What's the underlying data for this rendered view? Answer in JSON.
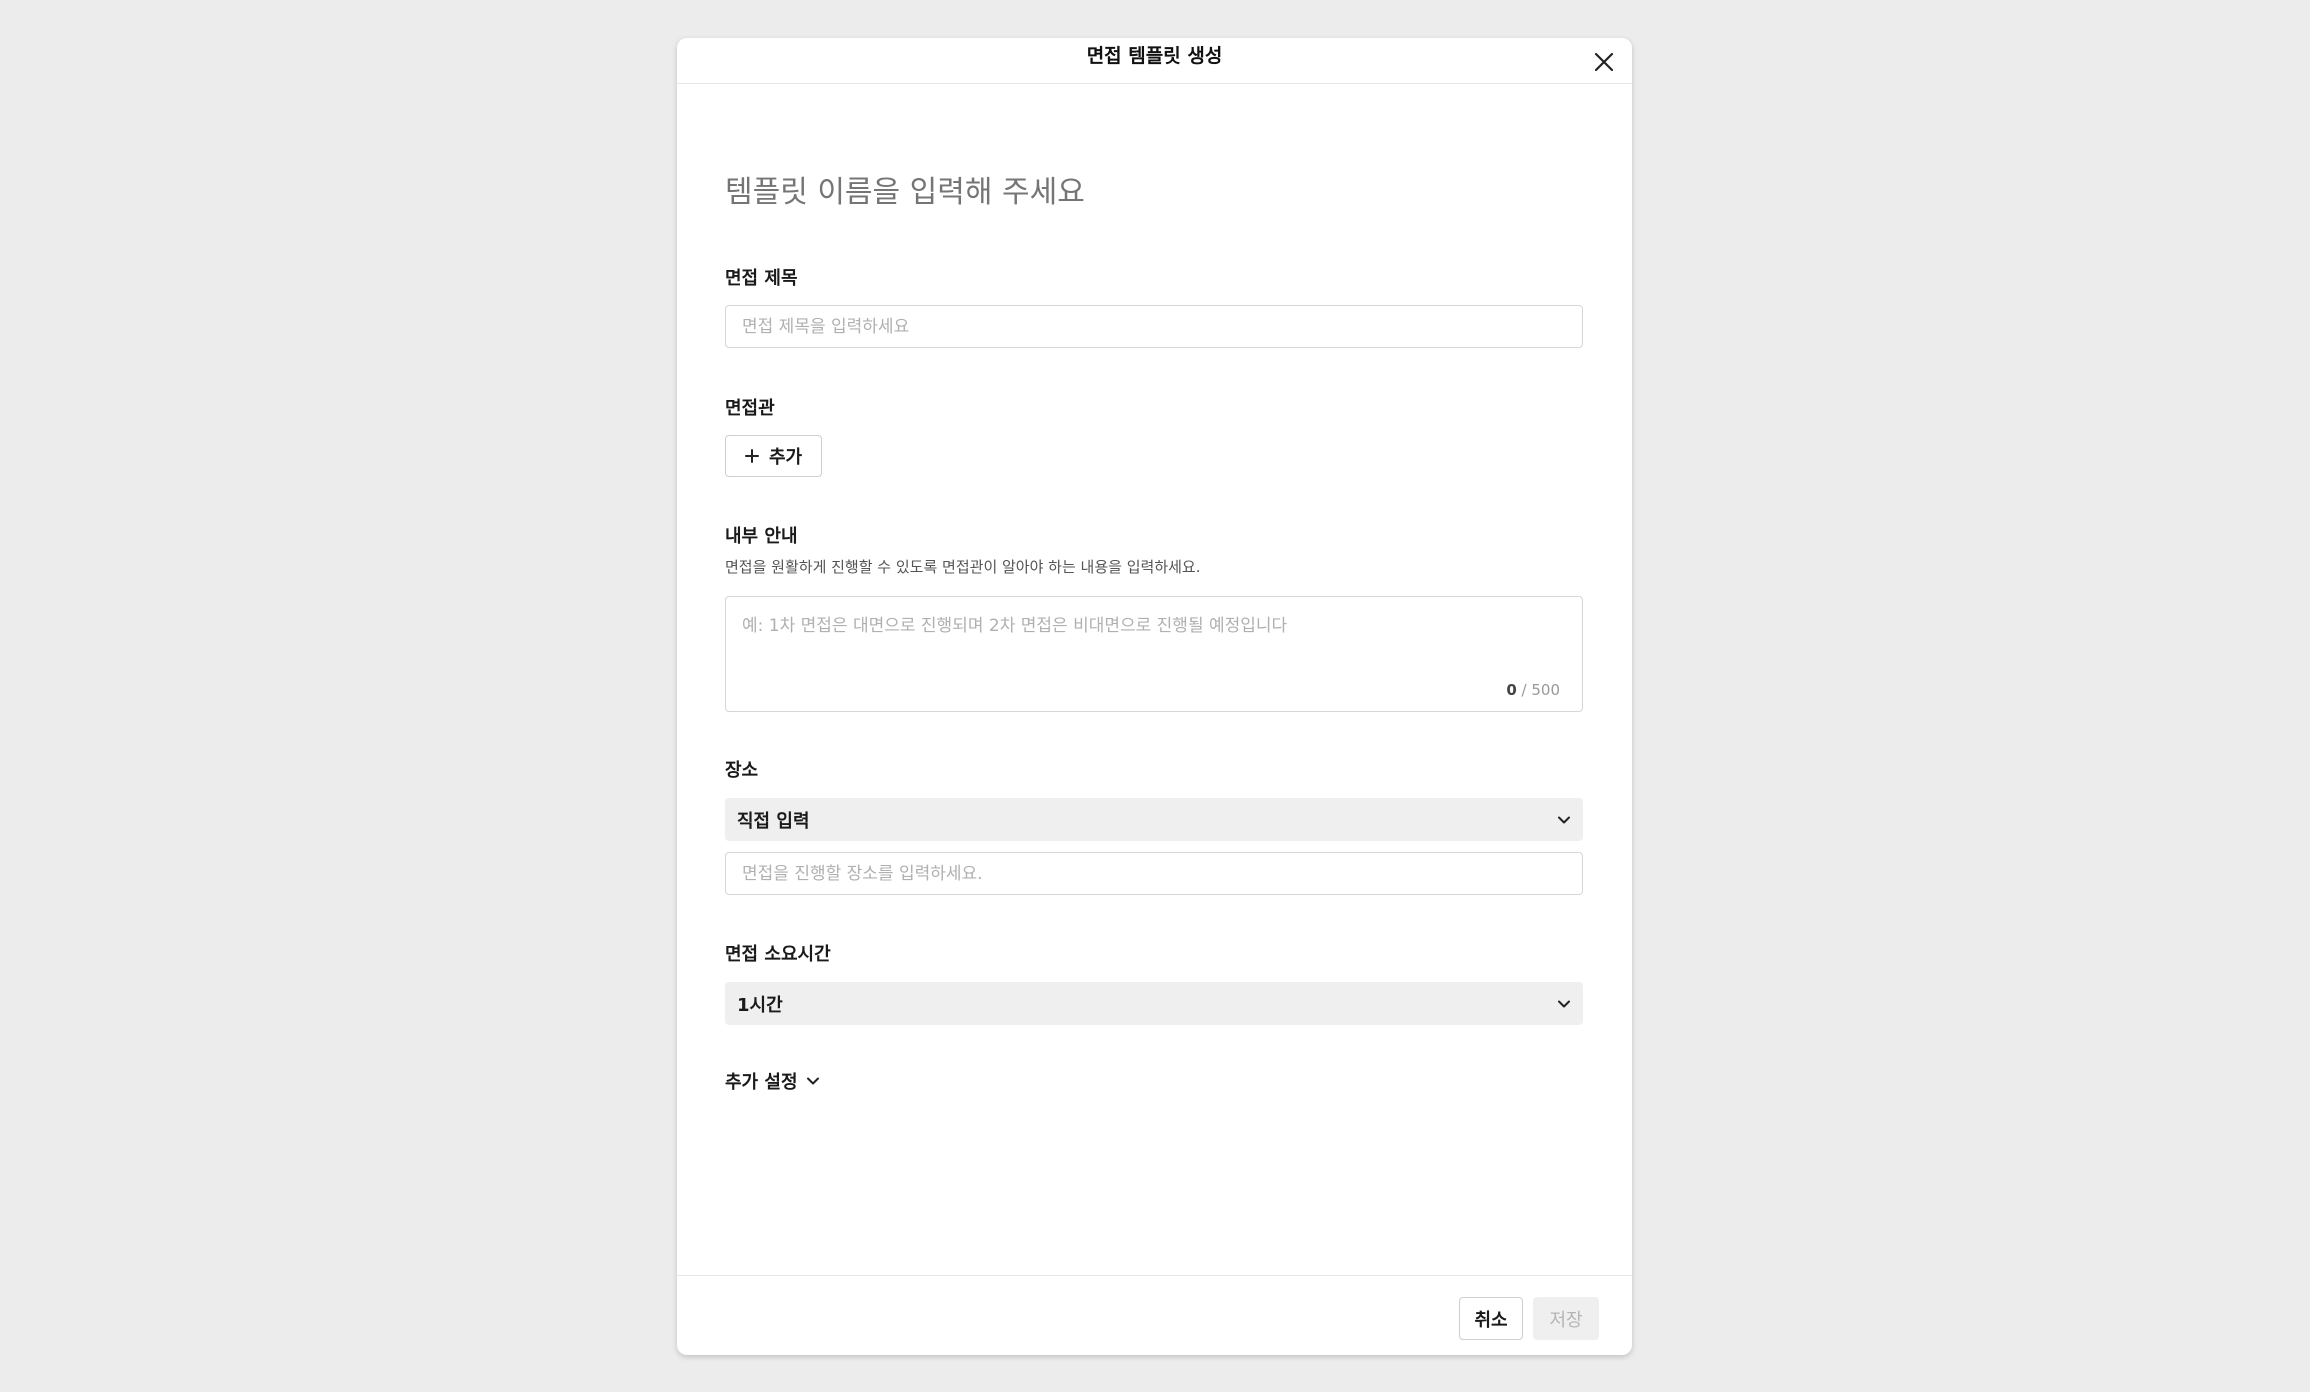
{
  "modal": {
    "title": "면접 템플릿 생성",
    "template_name_placeholder": "템플릿 이름을 입력해 주세요"
  },
  "interview_title": {
    "label": "면접 제목",
    "placeholder": "면접 제목을 입력하세요"
  },
  "interviewers": {
    "label": "면접관",
    "add_label": "추가"
  },
  "internal_guide": {
    "label": "내부 안내",
    "description": "면접을 원활하게 진행할 수 있도록 면접관이 알아야 하는 내용을 입력하세요.",
    "placeholder": "예: 1차 면접은 대면으로 진행되며 2차 면접은 비대면으로 진행될 예정입니다",
    "char_current": "0",
    "char_max": "/ 500"
  },
  "location": {
    "label": "장소",
    "selected": "직접 입력",
    "placeholder": "면접을 진행할 장소를 입력하세요."
  },
  "duration": {
    "label": "면접 소요시간",
    "selected": "1시간"
  },
  "more_settings": {
    "label": "추가 설정"
  },
  "footer": {
    "cancel_label": "취소",
    "save_label": "저장"
  },
  "icons": {
    "close": "close-icon",
    "plus": "plus-icon",
    "chevron": "chevron-down-icon"
  }
}
